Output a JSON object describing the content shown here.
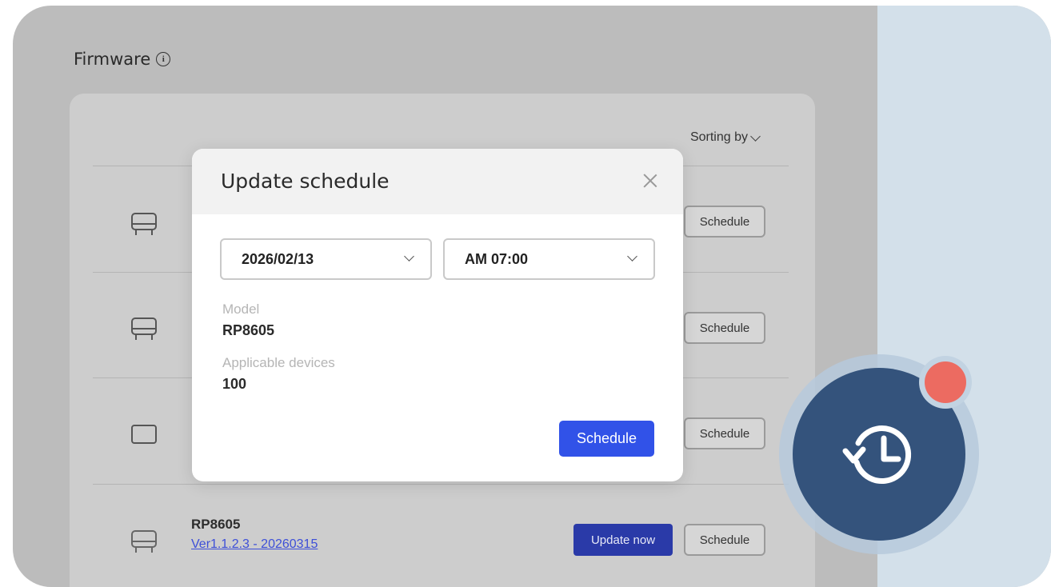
{
  "page": {
    "title": "Firmware"
  },
  "list": {
    "sorting_label": "Sorting by",
    "rows": [
      {
        "model": "",
        "version": "",
        "schedule_label": "Schedule",
        "icon": "tv-stand-icon"
      },
      {
        "model": "",
        "version": "",
        "schedule_label": "Schedule",
        "icon": "tv-stand-icon"
      },
      {
        "model": "",
        "version": "",
        "schedule_label": "Schedule",
        "icon": "monitor-icon"
      },
      {
        "model": "RP8605",
        "version": "Ver1.1.2.3 - 20260315",
        "update_label": "Update now",
        "schedule_label": "Schedule",
        "icon": "tv-stand-icon"
      }
    ]
  },
  "modal": {
    "title": "Update schedule",
    "date_value": "2026/02/13",
    "time_value": "AM 07:00",
    "model_label": "Model",
    "model_value": "RP8605",
    "devices_label": "Applicable devices",
    "devices_value": "100",
    "schedule_button": "Schedule"
  },
  "fab": {
    "icon": "history-clock-icon",
    "badge_color": "#ec6b61",
    "color": "#34537c"
  },
  "colors": {
    "primary": "#3152e8",
    "update_button": "#2a3aa8",
    "link": "#3d4fd8"
  }
}
